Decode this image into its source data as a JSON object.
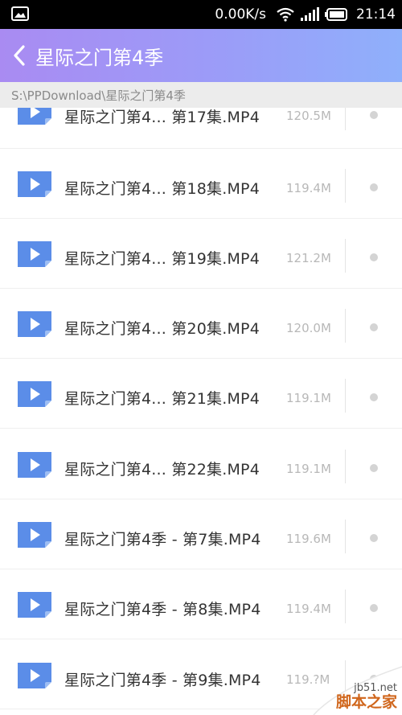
{
  "status_bar": {
    "net_speed": "0.00K/s",
    "time": "21:14",
    "icons": [
      "gallery-icon",
      "wifi-icon",
      "signal-icon",
      "battery-icon"
    ]
  },
  "header": {
    "title": "星际之门第4季",
    "back_icon": "chevron-left-icon",
    "gradient": [
      "#a98bf2",
      "#8fb0fb"
    ]
  },
  "path": "S:\\PPDownload\\星际之门第4季",
  "files": [
    {
      "name": "星际之门第4... 第17集.MP4",
      "size": "120.5M"
    },
    {
      "name": "星际之门第4... 第18集.MP4",
      "size": "119.4M"
    },
    {
      "name": "星际之门第4... 第19集.MP4",
      "size": "121.2M"
    },
    {
      "name": "星际之门第4... 第20集.MP4",
      "size": "120.0M"
    },
    {
      "name": "星际之门第4... 第21集.MP4",
      "size": "119.1M"
    },
    {
      "name": "星际之门第4... 第22集.MP4",
      "size": "119.1M"
    },
    {
      "name": "星际之门第4季 - 第7集.MP4",
      "size": "119.6M"
    },
    {
      "name": "星际之门第4季 - 第8集.MP4",
      "size": "119.4M"
    },
    {
      "name": "星际之门第4季 - 第9集.MP4",
      "size": "119.?M"
    }
  ],
  "icon_color": "#5b8de8",
  "watermark": {
    "url": "jb51.net",
    "name": "脚本之家"
  }
}
